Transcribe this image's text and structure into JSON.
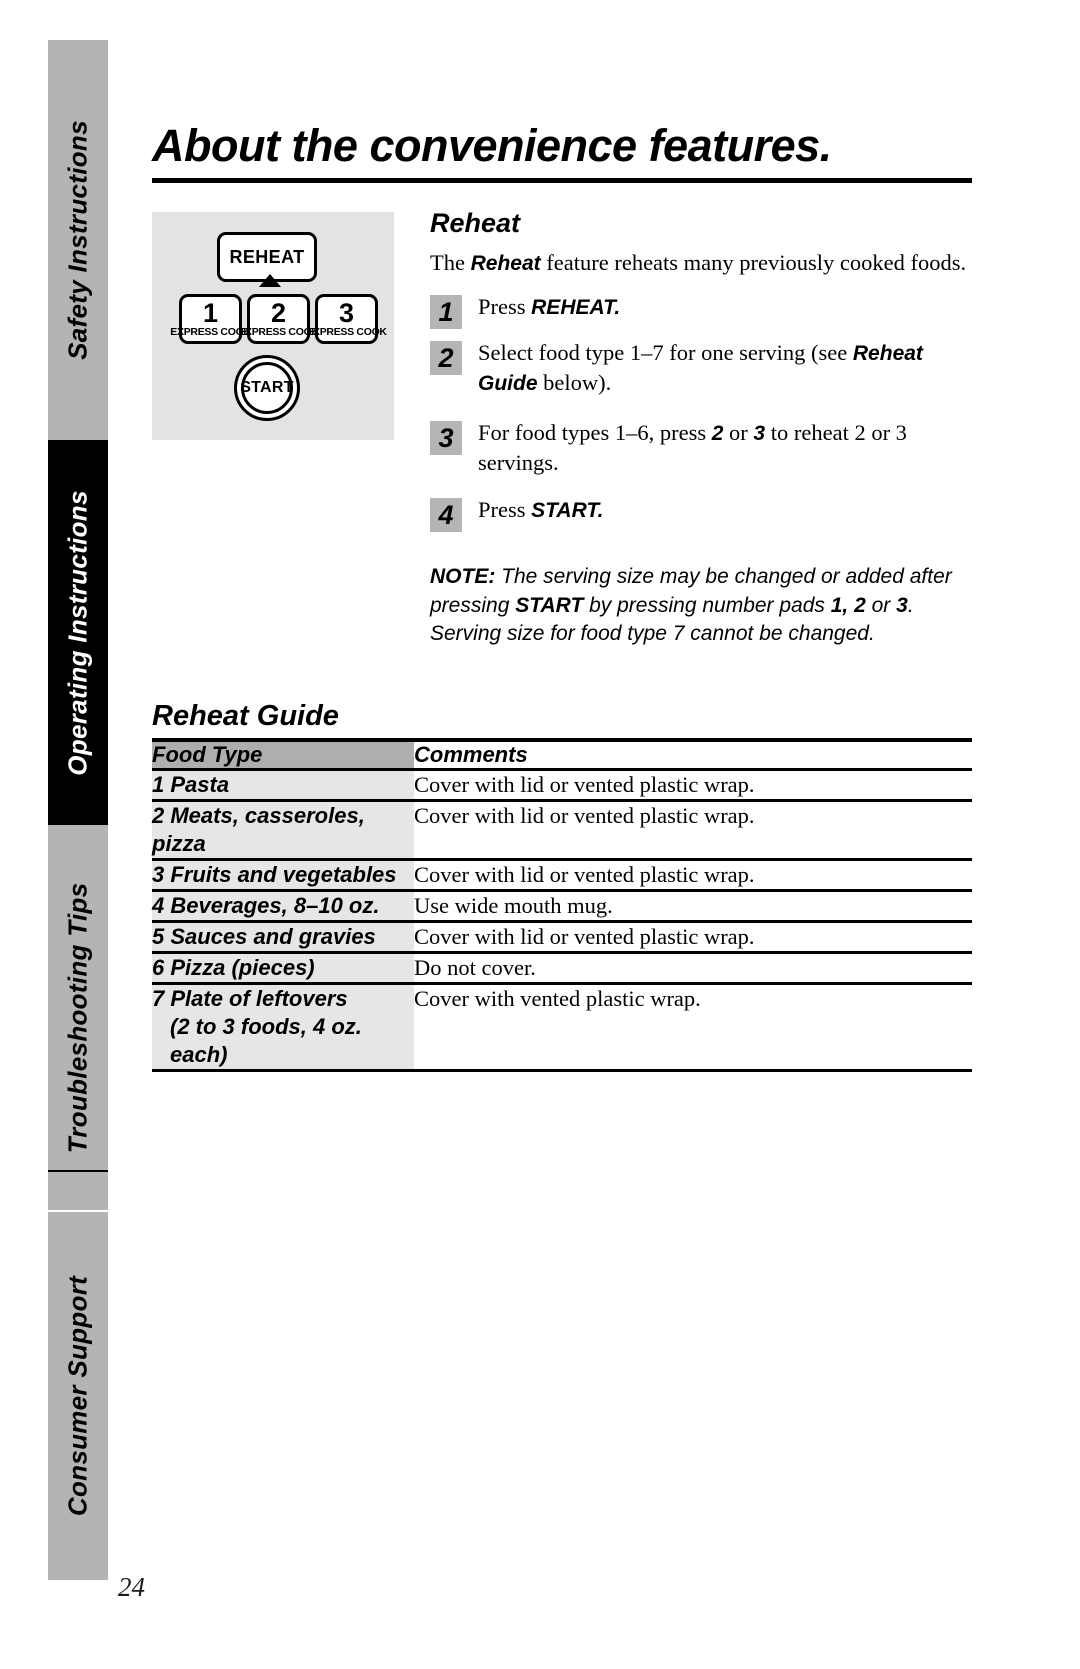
{
  "page": {
    "title": "About the convenience features.",
    "number": "24"
  },
  "sidebar": {
    "tabs": [
      {
        "label": "Safety Instructions",
        "active": false
      },
      {
        "label": "Operating Instructions",
        "active": true
      },
      {
        "label": "Troubleshooting Tips",
        "active": false
      },
      {
        "label": "Consumer Support",
        "active": false
      }
    ]
  },
  "control_panel": {
    "reheat_key": "REHEAT",
    "number_keys": [
      {
        "number": "1",
        "sublabel": "EXPRESS COOK"
      },
      {
        "number": "2",
        "sublabel": "EXPRESS COOK"
      },
      {
        "number": "3",
        "sublabel": "EXPRESS COOK"
      }
    ],
    "start_key": "START"
  },
  "reheat": {
    "heading": "Reheat",
    "intro_before": "The ",
    "intro_bold": "Reheat",
    "intro_after": " feature reheats many previously cooked foods.",
    "steps": [
      {
        "num": "1",
        "parts": [
          {
            "text": "Press ",
            "style": "serif"
          },
          {
            "text": "REHEAT.",
            "style": "sans-bold"
          }
        ]
      },
      {
        "num": "2",
        "parts": [
          {
            "text": "Select food type 1–7 for one serving (see ",
            "style": "serif"
          },
          {
            "text": "Reheat Guide",
            "style": "sans-bold-italic"
          },
          {
            "text": " below).",
            "style": "serif"
          }
        ]
      },
      {
        "num": "3",
        "parts": [
          {
            "text": "For food types 1–6, press ",
            "style": "serif"
          },
          {
            "text": "2",
            "style": "sans-bold"
          },
          {
            "text": " or ",
            "style": "serif"
          },
          {
            "text": "3",
            "style": "sans-bold"
          },
          {
            "text": "  to reheat 2 or 3 servings.",
            "style": "serif"
          }
        ]
      },
      {
        "num": "4",
        "parts": [
          {
            "text": "Press ",
            "style": "serif"
          },
          {
            "text": "START.",
            "style": "sans-bold"
          }
        ]
      }
    ],
    "note": {
      "label": "NOTE:",
      "t1": " The serving size may be changed or added after pressing ",
      "b1": "START",
      "t2": " by pressing number pads ",
      "b2": "1, 2",
      "t3": " or ",
      "b3": "3",
      "t4": ". Serving size for food type 7 cannot be changed."
    }
  },
  "guide": {
    "title": "Reheat Guide",
    "headers": [
      "Food Type",
      "Comments"
    ],
    "rows": [
      {
        "food": "1 Pasta",
        "food_sub": "",
        "comment": "Cover with lid or vented plastic wrap."
      },
      {
        "food": "2 Meats, casseroles, pizza",
        "food_sub": "",
        "comment": "Cover with lid or vented plastic wrap."
      },
      {
        "food": "3 Fruits and vegetables",
        "food_sub": "",
        "comment": "Cover with lid or vented plastic wrap."
      },
      {
        "food": "4 Beverages, 8–10 oz.",
        "food_sub": "",
        "comment": "Use wide mouth mug."
      },
      {
        "food": "5 Sauces and gravies",
        "food_sub": "",
        "comment": "Cover with lid or vented plastic wrap."
      },
      {
        "food": "6 Pizza (pieces)",
        "food_sub": "",
        "comment": "Do not cover."
      },
      {
        "food": "7 Plate of leftovers",
        "food_sub": "(2 to 3 foods, 4 oz. each)",
        "comment": "Cover with vented plastic wrap."
      }
    ]
  },
  "colors": {
    "tab_inactive_bg": "#b4b4b4",
    "tab_active_bg": "#000000",
    "panel_bg": "#e3e3e3",
    "step_num_bg": "#b5b5b5",
    "table_header_bg": "#aeaeae",
    "table_food_bg": "#e6e6e6"
  }
}
